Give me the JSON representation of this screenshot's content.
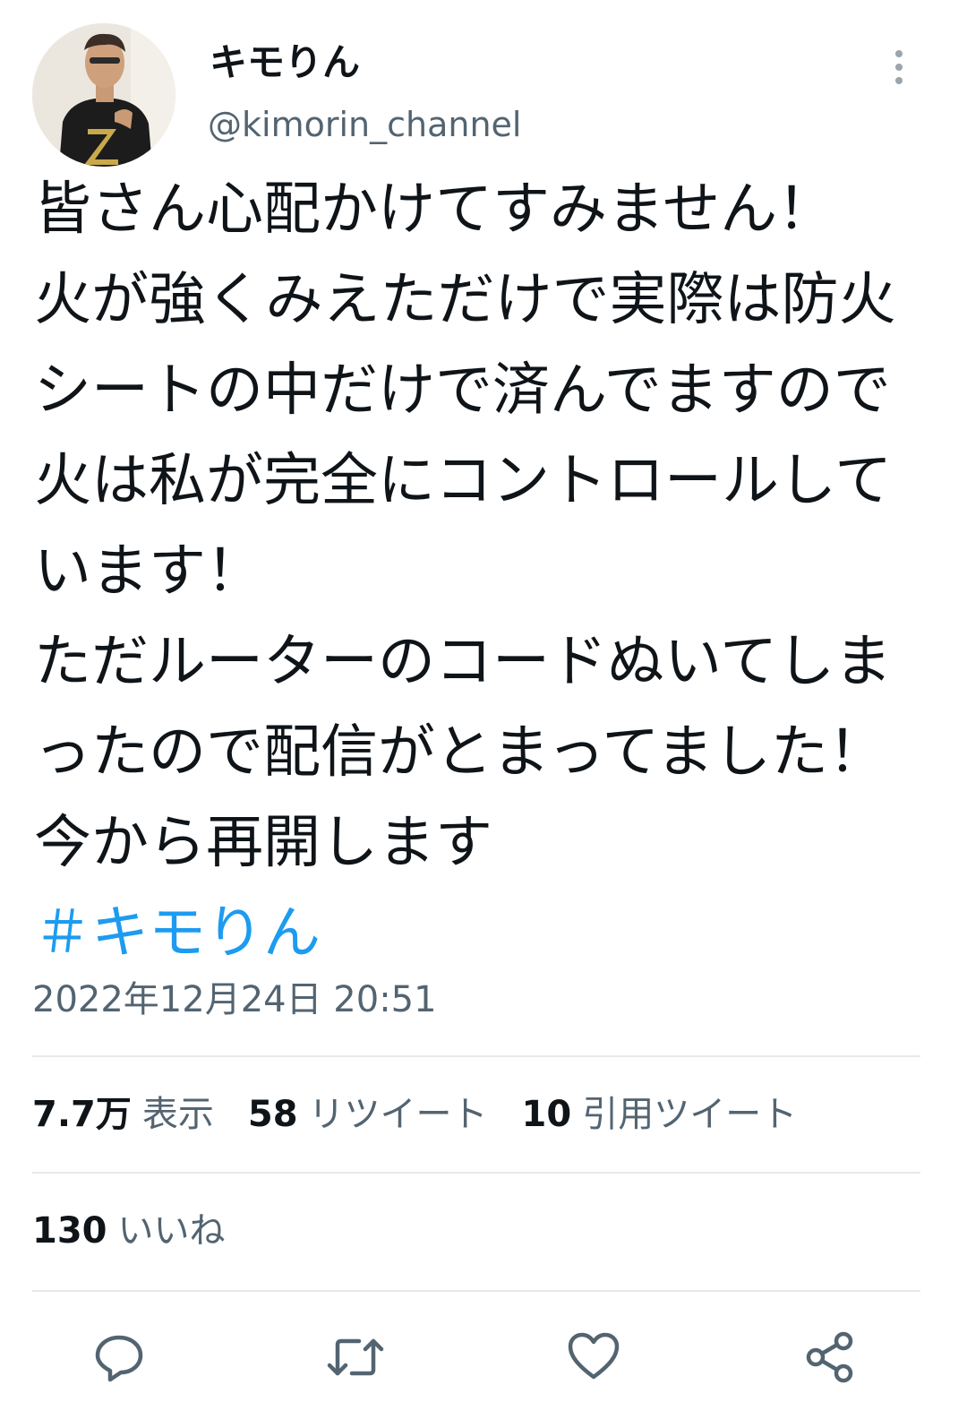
{
  "author": {
    "display_name": "キモりん",
    "handle": "@kimorin_channel"
  },
  "tweet": {
    "lines": [
      "皆さん心配かけてすみません！",
      "火が強くみえただけで実際は防火",
      "シートの中だけで済んでますので",
      "火は私が完全にコントロールして",
      "います！",
      "ただルーターのコードぬいてしま",
      "ったので配信がとまってました！",
      "今から再開します"
    ],
    "hashtag": "＃キモりん",
    "timestamp": "2022年12月24日 20:51"
  },
  "stats": {
    "views_count": "7.7万",
    "views_label": "表示",
    "retweets_count": "58",
    "retweets_label": "リツイート",
    "quotes_count": "10",
    "quotes_label": "引用ツイート",
    "likes_count": "130",
    "likes_label": "いいね"
  },
  "icons": {
    "more": "more-vertical-icon",
    "reply": "reply-icon",
    "retweet": "retweet-icon",
    "like": "heart-icon",
    "share": "share-icon"
  },
  "colors": {
    "text_primary": "#0f1419",
    "text_secondary": "#536471",
    "hashtag": "#1d9bf0",
    "divider": "#e6e9ec"
  }
}
